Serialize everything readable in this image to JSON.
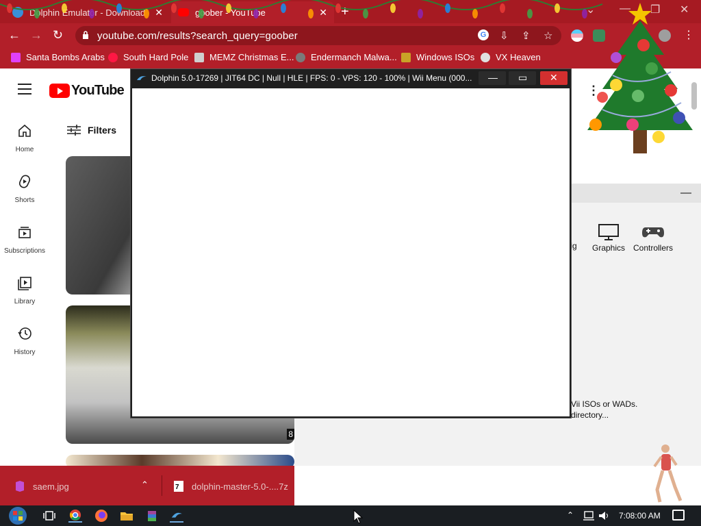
{
  "browser": {
    "tabs": [
      {
        "title": "Dolphin Emulator - Download",
        "active": false
      },
      {
        "title": "goober - YouTube",
        "active": true
      }
    ],
    "new_tab_glyph": "+",
    "url": "youtube.com/results?search_query=goober",
    "bookmarks": [
      {
        "label": "Santa Bombs Arabs",
        "icon": "santa-bookmark-icon"
      },
      {
        "label": "South Hard Pole",
        "icon": "snowflake-bookmark-icon"
      },
      {
        "label": "MEMZ Christmas E...",
        "icon": "memz-bookmark-icon"
      },
      {
        "label": "Endermanch Malwa...",
        "icon": "endermanch-bookmark-icon"
      },
      {
        "label": "Windows ISOs",
        "icon": "windows-isos-bookmark-icon"
      },
      {
        "label": "VX Heaven",
        "icon": "vx-heaven-bookmark-icon"
      }
    ]
  },
  "youtube": {
    "logo_text": "YouTube",
    "sidebar": [
      {
        "label": "Home",
        "icon": "home-icon"
      },
      {
        "label": "Shorts",
        "icon": "shorts-icon"
      },
      {
        "label": "Subscriptions",
        "icon": "subscriptions-icon"
      },
      {
        "label": "Library",
        "icon": "library-icon"
      },
      {
        "label": "History",
        "icon": "history-icon"
      }
    ],
    "filters_label": "Filters",
    "thumb_duration_fragment": "8"
  },
  "dolphin_main": {
    "tools": [
      {
        "label": "fig",
        "icon": "config-icon"
      },
      {
        "label": "Graphics",
        "icon": "graphics-icon"
      },
      {
        "label": "Controllers",
        "icon": "controllers-icon"
      }
    ],
    "message_line1": "Vii ISOs or WADs.",
    "message_line2": "directory..."
  },
  "dolphin_window": {
    "title": "Dolphin 5.0-17269 | JIT64 DC | Null | HLE | FPS: 0 - VPS: 120 - 100% | Wii Menu (000..."
  },
  "downloads": [
    {
      "name": "saem.jpg",
      "icon": "image-file-icon"
    },
    {
      "name": "dolphin-master-5.0-....7z",
      "icon": "archive-file-icon"
    }
  ],
  "taskbar": {
    "apps": [
      "start-orb-icon",
      "task-view-icon",
      "chrome-icon",
      "firefox-icon",
      "file-explorer-icon",
      "winrar-icon",
      "dolphin-icon"
    ],
    "clock": "7:08:00 AM"
  },
  "colors": {
    "chrome_red": "#b21f29",
    "tab_strip_red": "#a61a22",
    "youtube_red": "#ff0000",
    "dolphin_titlebar": "#1f1f1f",
    "close_button_red": "#d32f2f",
    "taskbar": "#1a1e22"
  }
}
